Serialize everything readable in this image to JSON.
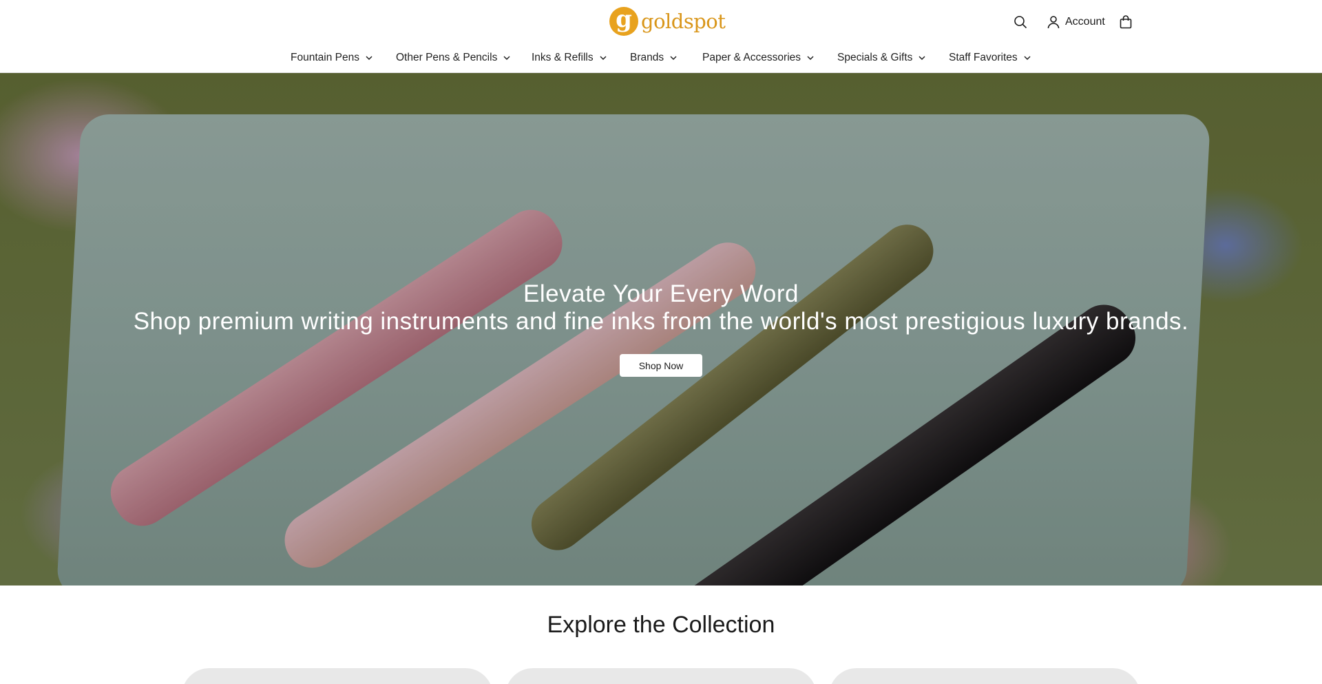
{
  "header": {
    "logo_mark": "g",
    "logo_text": "goldspot",
    "account_label": "Account"
  },
  "nav": {
    "items": [
      {
        "label": "Fountain Pens"
      },
      {
        "label": "Other Pens & Pencils"
      },
      {
        "label": "Inks & Refills"
      },
      {
        "label": "Brands"
      },
      {
        "label": "Paper & Accessories"
      },
      {
        "label": "Specials & Gifts"
      },
      {
        "label": "Staff Favorites"
      }
    ]
  },
  "hero": {
    "title": "Elevate Your Every Word",
    "subtitle": "Shop premium writing instruments and fine inks from the world's most prestigious luxury brands.",
    "cta_label": "Shop Now"
  },
  "collection": {
    "title": "Explore the Collection"
  },
  "icons": {
    "search": "search-icon",
    "account": "user-icon",
    "cart": "shopping-bag-icon",
    "nav_chevron": "chevron-down-icon"
  },
  "colors": {
    "brand": "#e8a21e",
    "text": "#1a1a1a",
    "button_bg": "#ffffff"
  }
}
